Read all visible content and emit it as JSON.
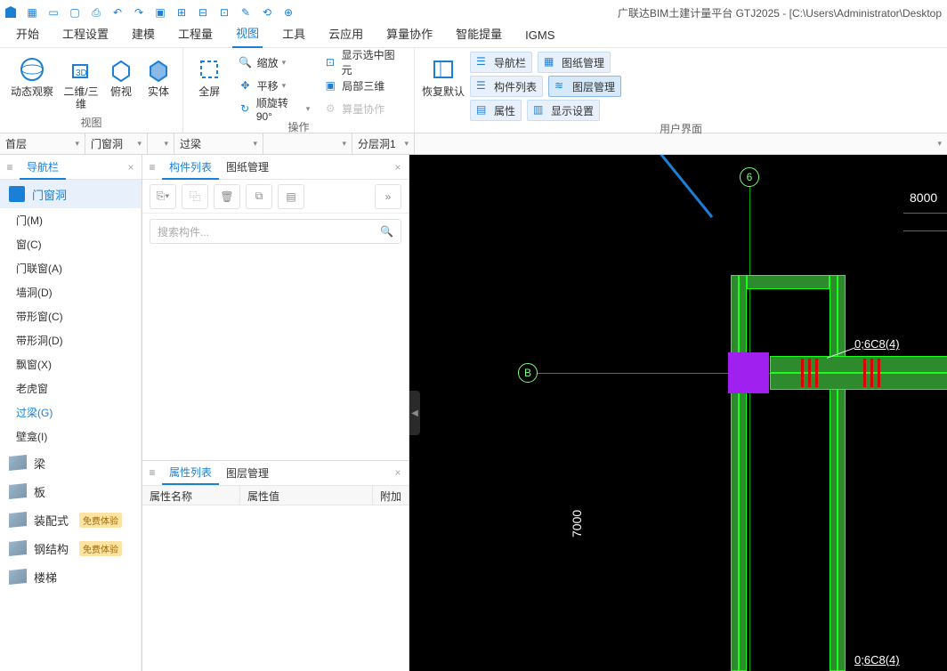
{
  "title": "广联达BIM土建计量平台 GTJ2025 - [C:\\Users\\Administrator\\Desktop",
  "menu": [
    "开始",
    "工程设置",
    "建模",
    "工程量",
    "视图",
    "工具",
    "云应用",
    "算量协作",
    "智能提量",
    "IGMS"
  ],
  "menu_active": 4,
  "ribbon": {
    "view_group": "视图",
    "dynamic": "动态观察",
    "two_three": "二维/三维",
    "top": "俯视",
    "solid": "实体",
    "fullscreen": "全屏",
    "ops_group": "操作",
    "zoom": "缩放",
    "pan": "平移",
    "rotate90": "顺旋转90°",
    "show_sel": "显示选中图元",
    "local3d": "局部三维",
    "calc_coop": "算量协作",
    "ui_group": "用户界面",
    "restore": "恢复默认",
    "navbar": "导航栏",
    "complist": "构件列表",
    "props": "属性",
    "drawmgr": "图纸管理",
    "layermgr": "图层管理",
    "dispset": "显示设置"
  },
  "dropdowns": {
    "floor": "首层",
    "cat": "门窗洞",
    "sub": "过梁",
    "layer": "分层洞1"
  },
  "nav": {
    "title": "导航栏",
    "group": "门窗洞",
    "items": [
      "门(M)",
      "窗(C)",
      "门联窗(A)",
      "墙洞(D)",
      "带形窗(C)",
      "带形洞(D)",
      "飘窗(X)",
      "老虎窗",
      "过梁(G)",
      "壁龛(I)"
    ],
    "sel": 8,
    "cats": [
      {
        "label": "梁",
        "badge": ""
      },
      {
        "label": "板",
        "badge": ""
      },
      {
        "label": "装配式",
        "badge": "免费体验"
      },
      {
        "label": "钢结构",
        "badge": "免费体验"
      },
      {
        "label": "楼梯",
        "badge": ""
      }
    ]
  },
  "complist": {
    "tab1": "构件列表",
    "tab2": "图纸管理",
    "search_ph": "搜索构件..."
  },
  "proplist": {
    "tab1": "属性列表",
    "tab2": "图层管理",
    "col1": "属性名称",
    "col2": "属性值",
    "col3": "附加"
  },
  "canvas": {
    "axis6": "6",
    "axisB": "B",
    "dim_h": "8000",
    "dim_v": "7000",
    "anno1": "0;6C8(4)",
    "anno2": "0;6C8(4)"
  }
}
